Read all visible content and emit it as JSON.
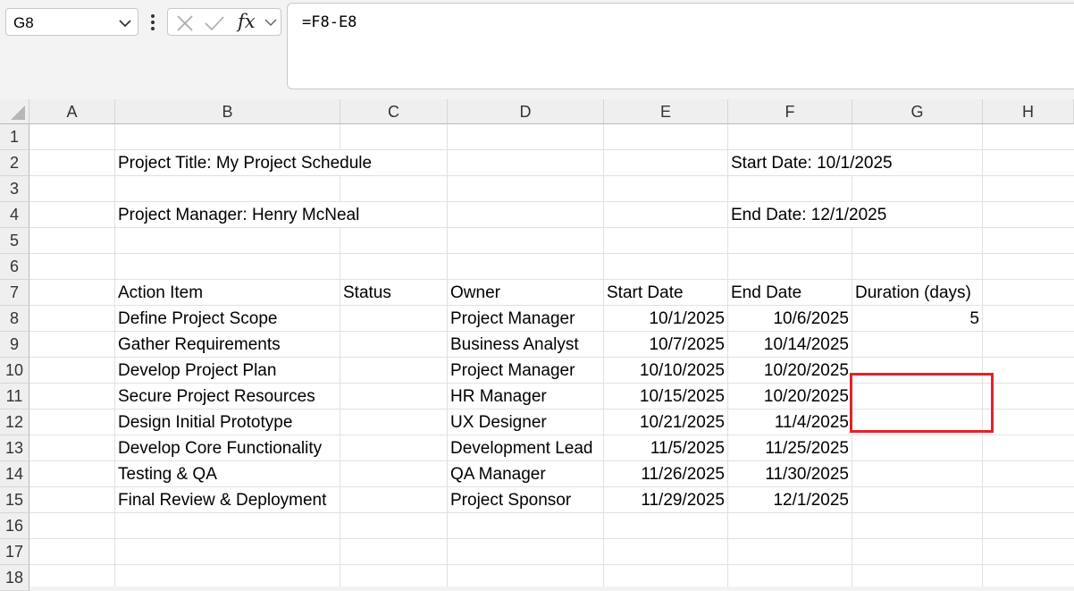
{
  "name_box": {
    "value": "G8"
  },
  "formula_bar": {
    "fx_label": "fx",
    "formula": "=F8-E8"
  },
  "columns": [
    "A",
    "B",
    "C",
    "D",
    "E",
    "F",
    "G",
    "H"
  ],
  "rows": [
    "1",
    "2",
    "3",
    "4",
    "5",
    "6",
    "7",
    "8",
    "9",
    "10",
    "11",
    "12",
    "13",
    "14",
    "15",
    "16",
    "17",
    "18"
  ],
  "info": {
    "project_title": "Project Title: My Project Schedule",
    "project_manager": "Project Manager: Henry McNeal",
    "start_date": "Start Date: 10/1/2025",
    "end_date": "End Date: 12/1/2025"
  },
  "table": {
    "headers": {
      "action_item": "Action Item",
      "status": "Status",
      "owner": "Owner",
      "start_date": "Start Date",
      "end_date": "End Date",
      "duration": "Duration (days)"
    },
    "rows": [
      {
        "action": "Define Project Scope",
        "status": "",
        "owner": "Project Manager",
        "start": "10/1/2025",
        "end": "10/6/2025",
        "duration": "5"
      },
      {
        "action": "Gather Requirements",
        "status": "",
        "owner": "Business Analyst",
        "start": "10/7/2025",
        "end": "10/14/2025",
        "duration": ""
      },
      {
        "action": "Develop Project Plan",
        "status": "",
        "owner": "Project Manager",
        "start": "10/10/2025",
        "end": "10/20/2025",
        "duration": ""
      },
      {
        "action": "Secure Project Resources",
        "status": "",
        "owner": "HR Manager",
        "start": "10/15/2025",
        "end": "10/20/2025",
        "duration": ""
      },
      {
        "action": "Design Initial Prototype",
        "status": "",
        "owner": "UX Designer",
        "start": "10/21/2025",
        "end": "11/4/2025",
        "duration": ""
      },
      {
        "action": "Develop Core Functionality",
        "status": "",
        "owner": "Development Lead",
        "start": "11/5/2025",
        "end": "11/25/2025",
        "duration": ""
      },
      {
        "action": "Testing & QA",
        "status": "",
        "owner": "QA Manager",
        "start": "11/26/2025",
        "end": "11/30/2025",
        "duration": ""
      },
      {
        "action": "Final Review & Deployment",
        "status": "",
        "owner": "Project Sponsor",
        "start": "11/29/2025",
        "end": "12/1/2025",
        "duration": ""
      }
    ]
  },
  "highlight_color": "#e32228"
}
